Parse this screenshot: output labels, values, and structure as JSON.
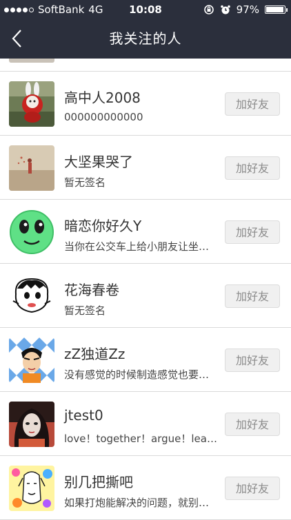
{
  "status_bar": {
    "carrier": "SoftBank",
    "network": "4G",
    "time": "10:08",
    "battery": "97%",
    "battery_level": 0.97,
    "signal_strength": 4
  },
  "nav": {
    "title": "我关注的人"
  },
  "follow_list": [
    {
      "name": "高中人2008",
      "signature": "000000000000",
      "button": "加好友",
      "avatar": "bunny-photo"
    },
    {
      "name": "大坚果哭了",
      "signature": "暂无签名",
      "button": "加好友",
      "avatar": "girl-field-photo"
    },
    {
      "name": "暗恋你好久Y",
      "signature": "当你在公交车上给小朋友让坐…",
      "button": "加好友",
      "avatar": "green-smiley"
    },
    {
      "name": "花海春卷",
      "signature": "暂无签名",
      "button": "加好友",
      "avatar": "cartoon-boy"
    },
    {
      "name": "zZ独道Zz",
      "signature": "没有感觉的时候制造感觉也要…",
      "button": "加好友",
      "avatar": "cartoon-man-argyle"
    },
    {
      "name": "jtest0",
      "signature": "love！together！argue！leave…",
      "button": "加好友",
      "avatar": "girl-portrait"
    },
    {
      "name": "别几把撕吧",
      "signature": "如果打炮能解决的问题，就别…",
      "button": "加好友",
      "avatar": "colorful-sketch"
    }
  ],
  "colors": {
    "nav_bg": "#2b2f3c",
    "divider": "#d9d9d9",
    "button_bg": "#f0f0f0",
    "button_text": "#8a8a8a"
  }
}
